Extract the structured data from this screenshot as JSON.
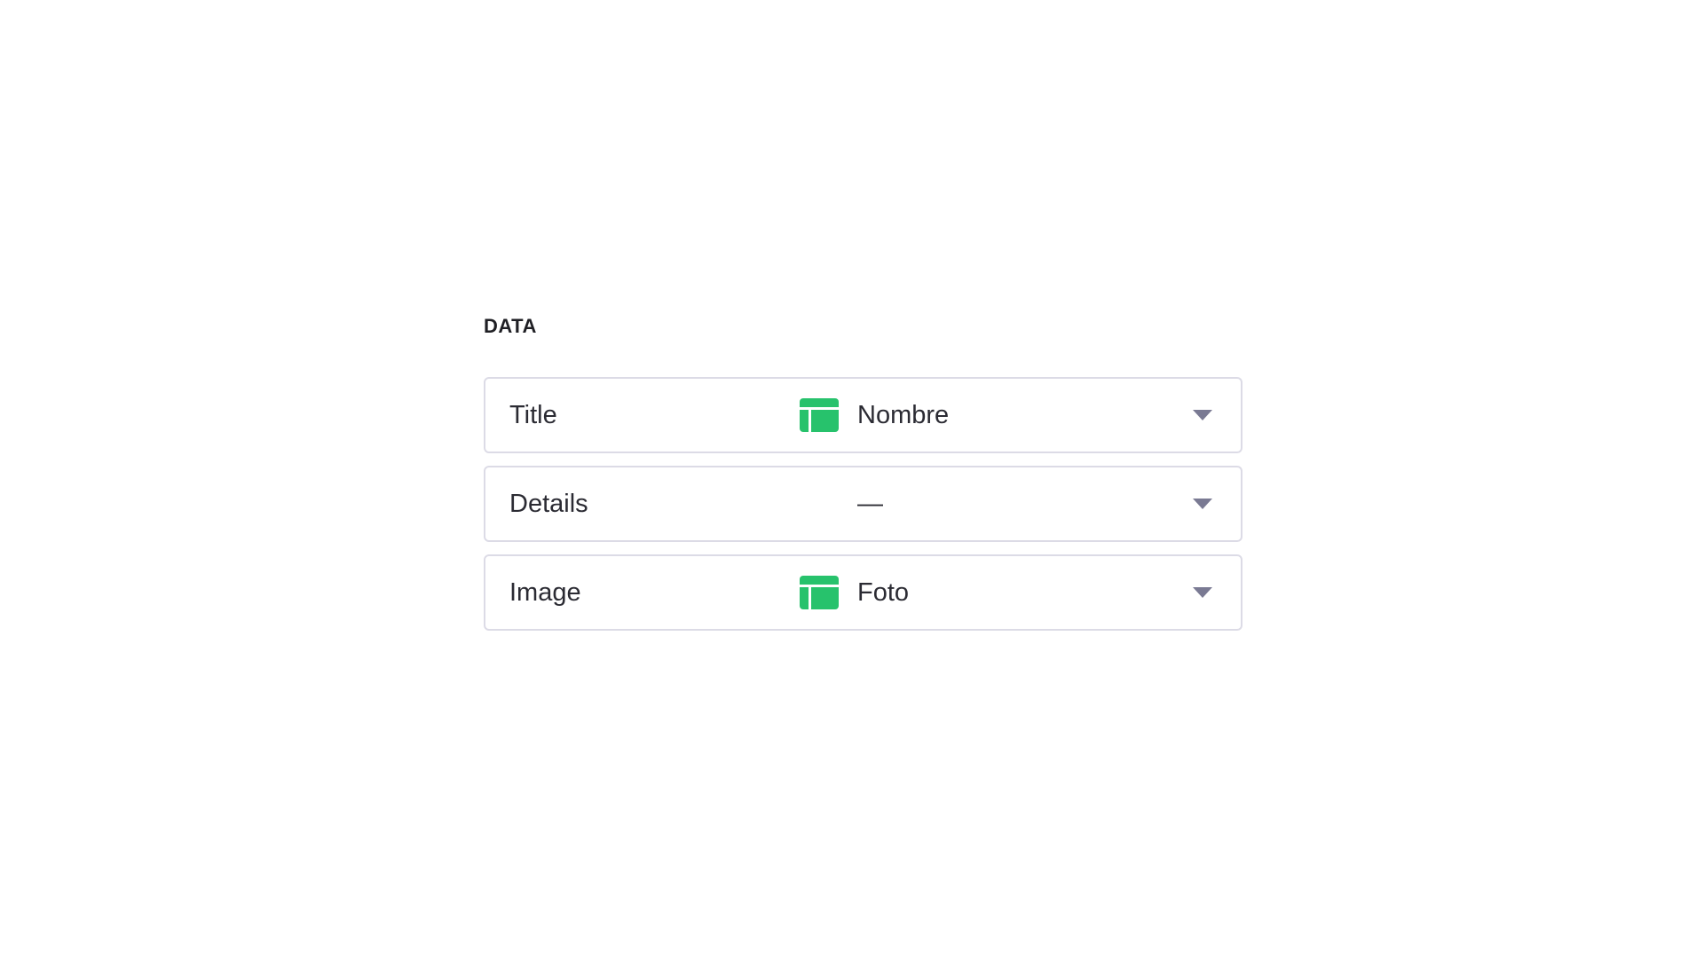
{
  "section": {
    "title": "DATA"
  },
  "rows": [
    {
      "label": "Title",
      "value": "Nombre",
      "icon": "table-icon"
    },
    {
      "label": "Details",
      "value": "—",
      "icon": ""
    },
    {
      "label": "Image",
      "value": "Foto",
      "icon": "table-icon"
    }
  ],
  "colors": {
    "table_icon": "#27c26c",
    "chevron": "#7a7a93",
    "border": "#dcdbe6"
  }
}
